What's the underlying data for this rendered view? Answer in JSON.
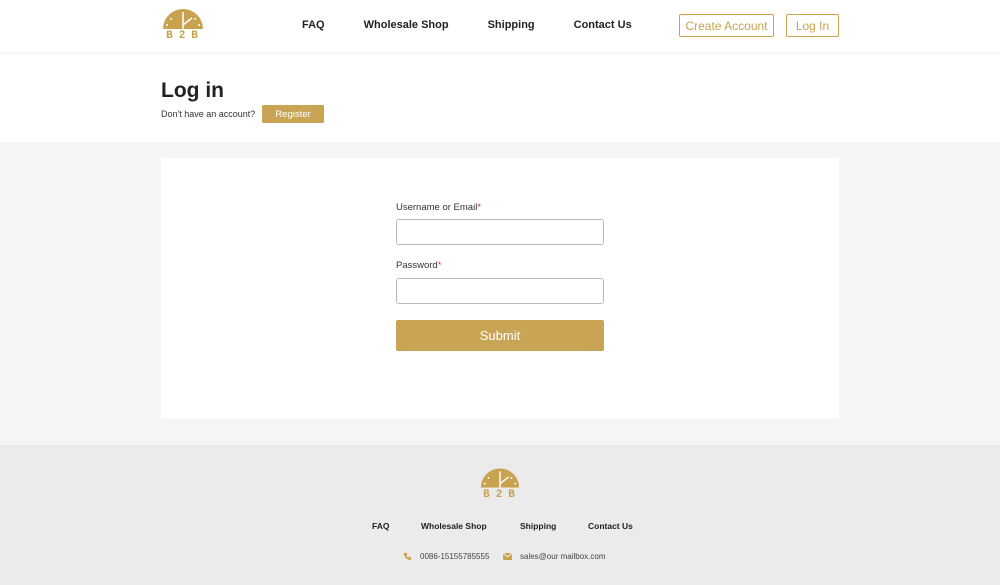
{
  "brand": {
    "logo_text": "B2B",
    "accent": "#c9a455"
  },
  "header": {
    "nav": [
      "FAQ",
      "Wholesale Shop",
      "Shipping",
      "Contact Us"
    ],
    "create_account": "Create Account",
    "log_in": "Log In"
  },
  "page": {
    "title": "Log in",
    "no_account": "Don't have an account?",
    "register": "Register"
  },
  "form": {
    "username_label": "Username or Email",
    "password_label": "Password",
    "required_mark": "*",
    "username_value": "",
    "password_value": "",
    "submit": "Submit"
  },
  "footer": {
    "nav": [
      "FAQ",
      "Wholesale Shop",
      "Shipping",
      "Contact Us"
    ],
    "phone": "0086-15155785555",
    "email": "sales@our mailbox.com"
  }
}
